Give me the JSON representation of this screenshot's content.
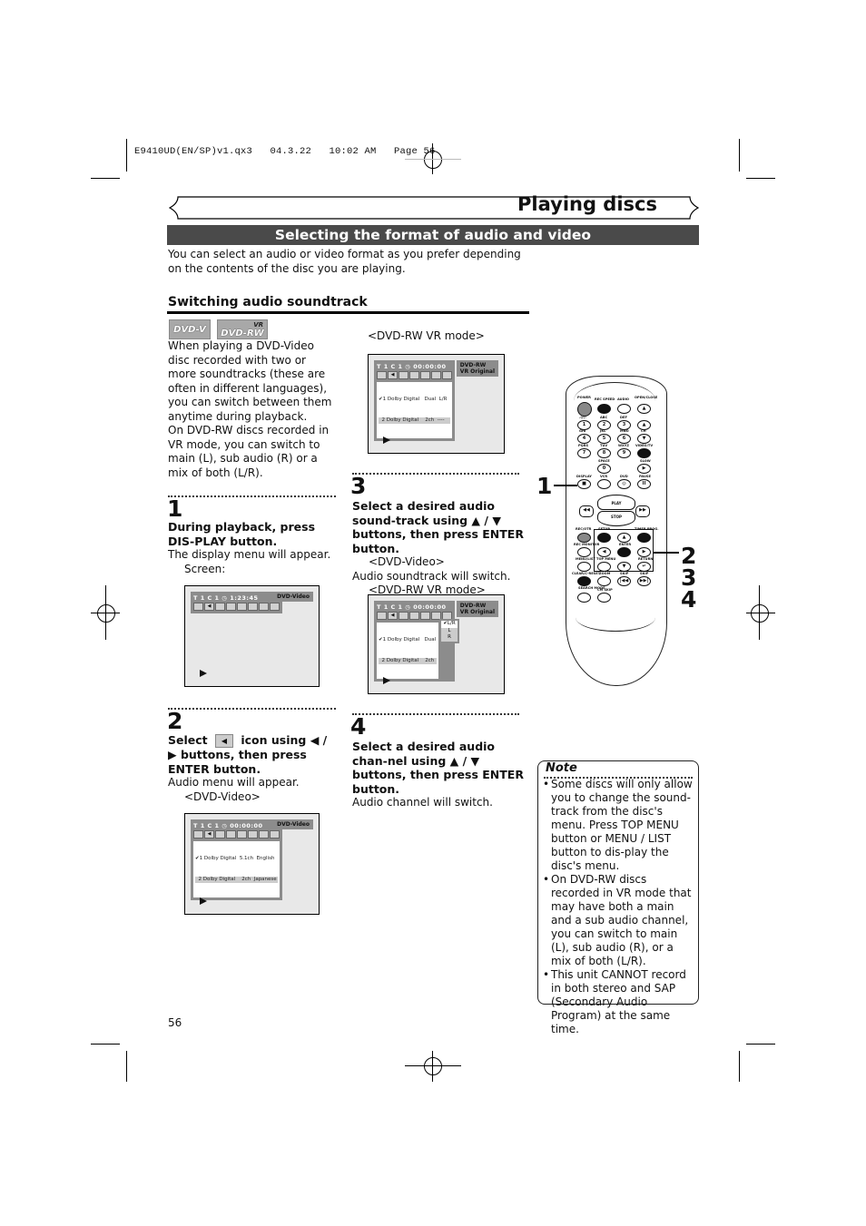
{
  "slug": "E9410UD(EN/SP)v1.qx3   04.3.22   10:02 AM   Page 56",
  "title": "Playing discs",
  "section": "Selecting the format of audio and video",
  "intro": "You can select an audio or video format as you prefer depending on the contents of the disc you are playing.",
  "subhead": "Switching audio soundtrack",
  "badges": {
    "dvdv": "DVD-V",
    "dvdrw": "DVD-RW",
    "vr": "VR"
  },
  "description": {
    "p1": "When playing a DVD-Video disc recorded with two or more soundtracks (these are often in different languages), you can switch between them anytime during playback.",
    "p2": "On DVD-RW discs recorded in VR mode, you can switch to main (L), sub audio (R) or a mix of both (L/R)."
  },
  "steps": [
    {
      "num": "1",
      "instruction": "During playback, press DIS-PLAY button.",
      "result": "The display menu will appear.",
      "sub": "Screen:"
    },
    {
      "num": "2",
      "instruction_pre": "Select",
      "instruction_post": "icon using ◀ / ▶ buttons, then press ENTER button.",
      "result": "Audio menu will appear.",
      "sub": "<DVD-Video>"
    },
    {
      "num": "3",
      "instruction": "Select a desired audio sound-track using ▲ / ▼ buttons, then press ENTER button.",
      "sub1": "<DVD-Video>",
      "result": "Audio soundtrack will switch.",
      "sub2": "<DVD-RW VR mode>"
    },
    {
      "num": "4",
      "instruction": "Select a desired audio chan-nel using ▲ / ▼ buttons, then press ENTER button.",
      "result": "Audio channel will switch."
    }
  ],
  "vr_mode_label_top": "<DVD-RW VR mode>",
  "screens": {
    "s1": {
      "status": "T  1  C  1  ◷   1:23:45",
      "label": "DVD-Video",
      "list": []
    },
    "s2": {
      "status": "T  1  C  1  ◷   00:00:00",
      "label": "DVD-Video",
      "list": [
        "✔1 Dolby Digital  5.1ch  English",
        "  2 Dolby Digital    2ch  Japanese"
      ]
    },
    "s3": {
      "status": "T  1  C  1  ◷   00:00:00",
      "label": "DVD-RW\nVR Original",
      "list": [
        "✔1 Dolby Digital   Dual  L/R",
        "  2 Dolby Digital    2ch  ----"
      ]
    },
    "s4": {
      "status": "T  1  C  1  ◷   00:00:00",
      "label": "DVD-RW\nVR Original",
      "list": [
        "✔1 Dolby Digital   Dual",
        "  2 Dolby Digital    2ch"
      ],
      "sublist": [
        "✔L/R",
        "L",
        "R"
      ]
    }
  },
  "remote": {
    "labels": [
      "POWER",
      "REC SPEED",
      "AUDIO",
      "OPEN/CLOSE",
      ".@/:",
      "ABC",
      "DEF",
      "GHI",
      "JKL",
      "MNO",
      "CH",
      "PQRS",
      "TUV",
      "WXYZ",
      "VIDEO/TV",
      "SPACE",
      "SLOW",
      "DISPLAY",
      "VCR",
      "DVD",
      "PAUSE",
      "PLAY",
      "STOP",
      "REC/OTR",
      "SETUP",
      "TIMER PROG.",
      "REC MONITOR",
      "ENTER",
      "MENU/LIST",
      "TOP MENU",
      "RETURN",
      "CLEAR/C-RESET",
      "ZOOM",
      "SKIP",
      "SKIP",
      "SEARCH MODE",
      "CM SKIP"
    ],
    "digits": [
      "1",
      "2",
      "3",
      "4",
      "5",
      "6",
      "7",
      "8",
      "9",
      "0"
    ]
  },
  "callouts": [
    "1",
    "2",
    "3",
    "4"
  ],
  "note": {
    "title": "Note",
    "items": [
      "Some discs will only allow you to change the sound-track from the disc's menu. Press TOP MENU button or MENU / LIST button to dis-play the disc's menu.",
      "On DVD-RW discs recorded in VR mode that may have both a main and a sub audio channel, you can switch to main (L), sub audio (R), or a mix of both (L/R).",
      "This unit CANNOT record in both stereo and SAP (Secondary Audio Program) at the same time."
    ]
  },
  "page_number": "56"
}
